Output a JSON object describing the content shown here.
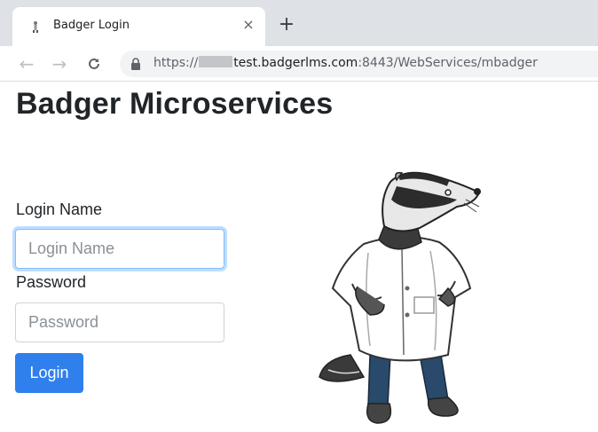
{
  "browser": {
    "tab": {
      "title": "Badger Login",
      "favicon": "badger-favicon-icon",
      "close_glyph": "×"
    },
    "new_tab_glyph": "+",
    "nav": {
      "back_glyph": "←",
      "forward_glyph": "→",
      "reload_glyph": "C"
    },
    "address": {
      "scheme": "https://",
      "host": "test.badgerlms.com",
      "rest": ":8443/WebServices/mbadger",
      "lock_icon": "lock-icon"
    }
  },
  "page": {
    "title": "Badger Microservices",
    "login_name_label": "Login Name",
    "login_name_placeholder": "Login Name",
    "password_label": "Password",
    "password_placeholder": "Password",
    "login_button": "Login",
    "illustration": "badger-in-lab-coat"
  },
  "colors": {
    "accent": "#2f80ed",
    "focus_border": "#80bdff",
    "text": "#212529"
  }
}
